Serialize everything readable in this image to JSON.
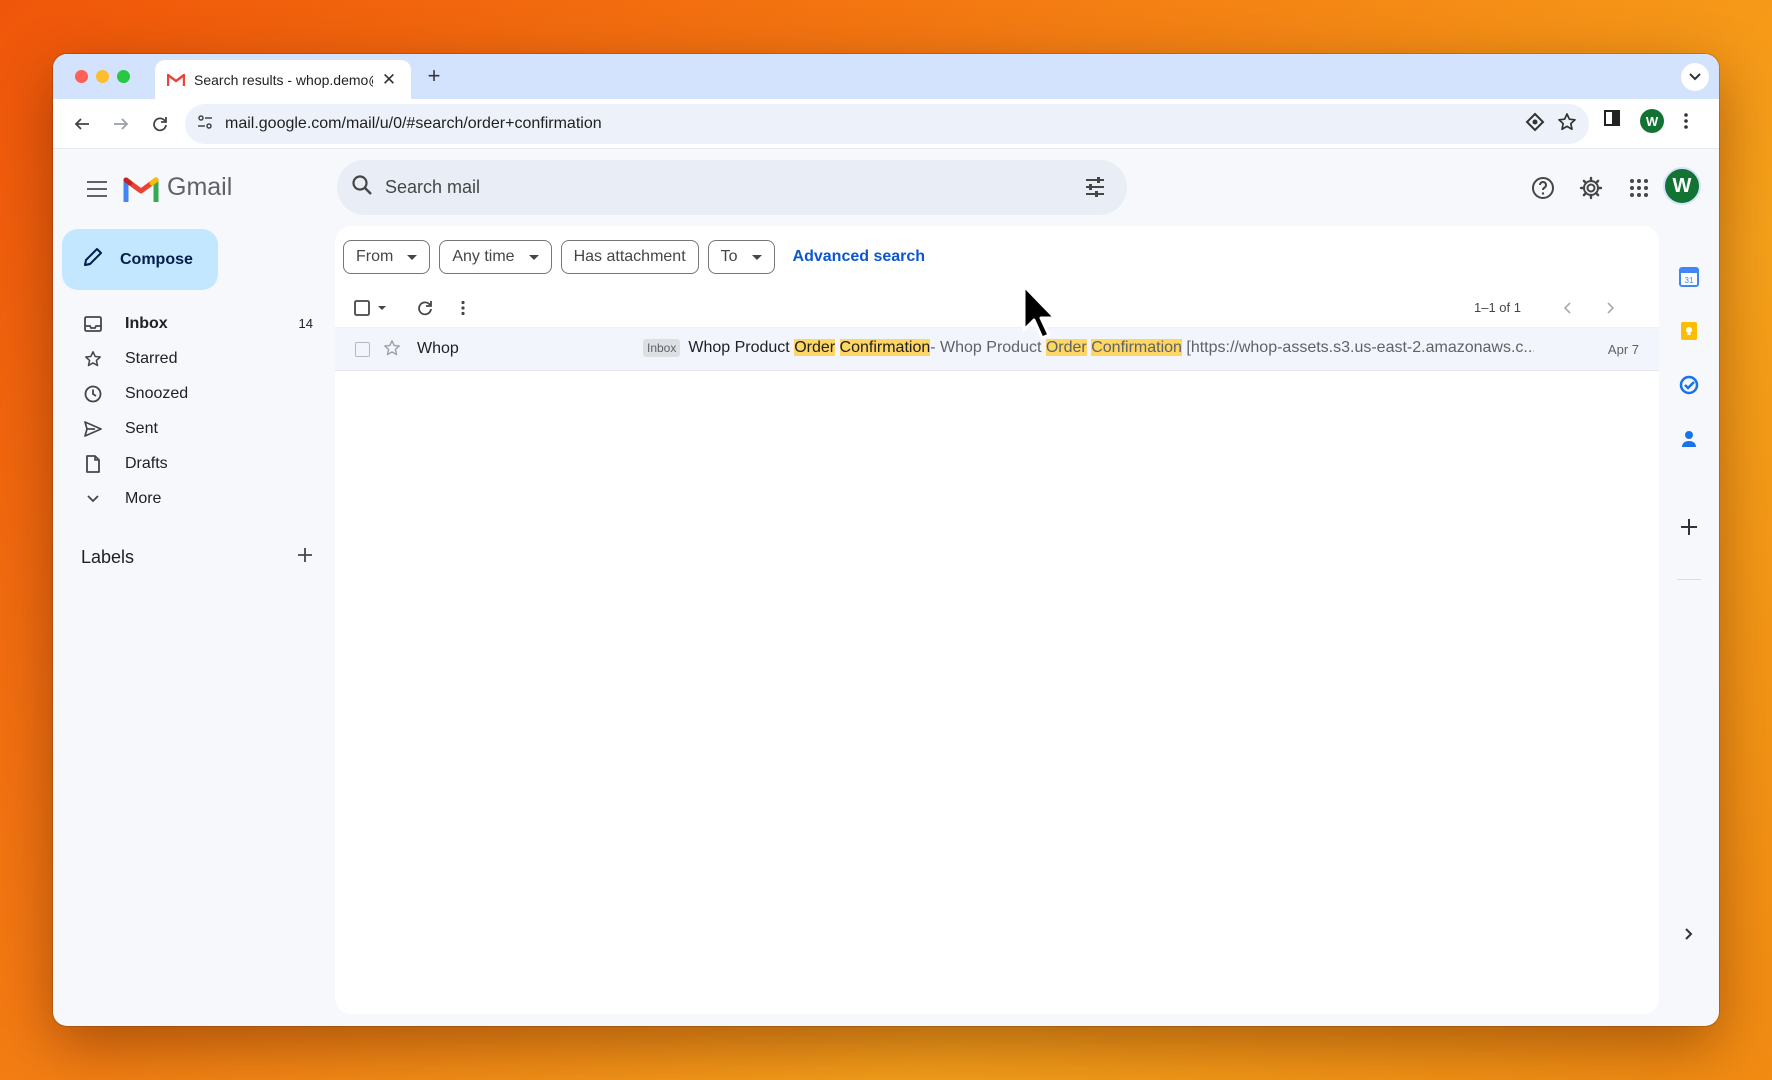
{
  "browser": {
    "tab_title": "Search results - whop.demo@",
    "url": "mail.google.com/mail/u/0/#search/order+confirmation",
    "profile_initial": "W"
  },
  "gmail": {
    "brand": "Gmail",
    "search_placeholder": "Search mail",
    "avatar_initial": "W",
    "compose_label": "Compose",
    "nav": [
      {
        "label": "Inbox",
        "count": "14",
        "icon": "inbox-icon"
      },
      {
        "label": "Starred",
        "count": "",
        "icon": "star-icon"
      },
      {
        "label": "Snoozed",
        "count": "",
        "icon": "clock-icon"
      },
      {
        "label": "Sent",
        "count": "",
        "icon": "send-icon"
      },
      {
        "label": "Drafts",
        "count": "",
        "icon": "draft-icon"
      },
      {
        "label": "More",
        "count": "",
        "icon": "chevron-down-icon"
      }
    ],
    "labels_title": "Labels",
    "filters": {
      "from": "From",
      "any_time": "Any time",
      "has_attachment": "Has attachment",
      "to": "To",
      "advanced": "Advanced search"
    },
    "page_count": "1–1 of 1",
    "emails": [
      {
        "sender": "Whop",
        "badge": "Inbox",
        "subject_parts": [
          "Whop Product ",
          "Order",
          " ",
          "Confirmation"
        ],
        "separator": " - ",
        "snippet_parts": [
          "Whop Product ",
          "Order",
          " ",
          "Confirmation",
          " [https://whop-assets.s3.us-east-2.amazonaws.c..."
        ],
        "date": "Apr 7"
      }
    ]
  },
  "colors": {
    "accent": "#0b57d0",
    "compose_bg": "#c2e7ff",
    "highlight": "#fdd663",
    "avatar": "#137333"
  }
}
